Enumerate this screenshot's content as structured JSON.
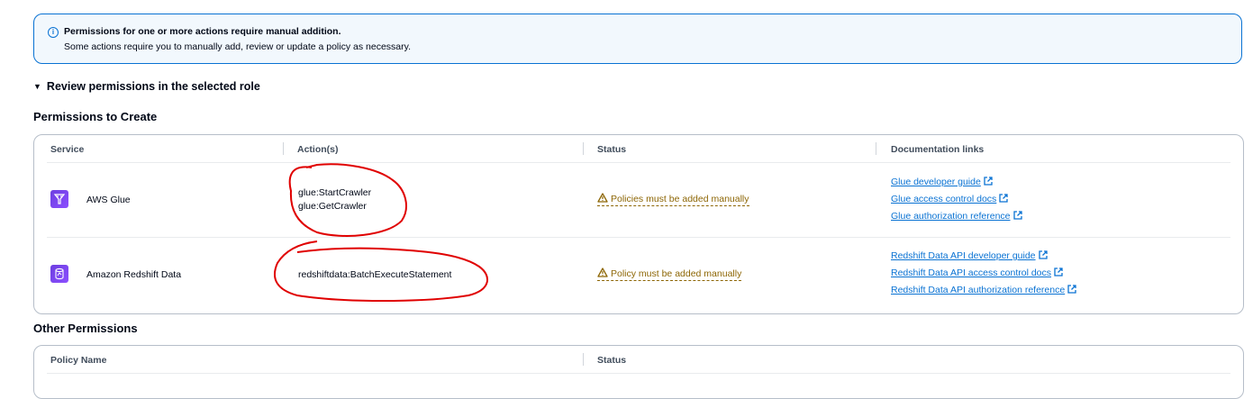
{
  "alert": {
    "title": "Permissions for one or more actions require manual addition.",
    "body": "Some actions require you to manually add, review or update a policy as necessary."
  },
  "expander": {
    "label": "Review permissions in the selected role"
  },
  "permissions_to_create": {
    "heading": "Permissions to Create",
    "columns": [
      "Service",
      "Action(s)",
      "Status",
      "Documentation links"
    ],
    "rows": [
      {
        "service": "AWS Glue",
        "actions": [
          "glue:StartCrawler",
          "glue:GetCrawler"
        ],
        "status": "Policies must be added manually",
        "links": [
          "Glue developer guide",
          "Glue access control docs",
          "Glue authorization reference"
        ]
      },
      {
        "service": "Amazon Redshift Data",
        "actions": [
          "redshiftdata:BatchExecuteStatement"
        ],
        "status": "Policy must be added manually",
        "links": [
          "Redshift Data API developer guide",
          "Redshift Data API access control docs",
          "Redshift Data API authorization reference"
        ]
      }
    ]
  },
  "other_permissions": {
    "heading": "Other Permissions",
    "columns": [
      "Policy Name",
      "Status"
    ]
  },
  "colors": {
    "link": "#0972d3",
    "warning": "#8d6605",
    "annotation": "#e00000"
  }
}
